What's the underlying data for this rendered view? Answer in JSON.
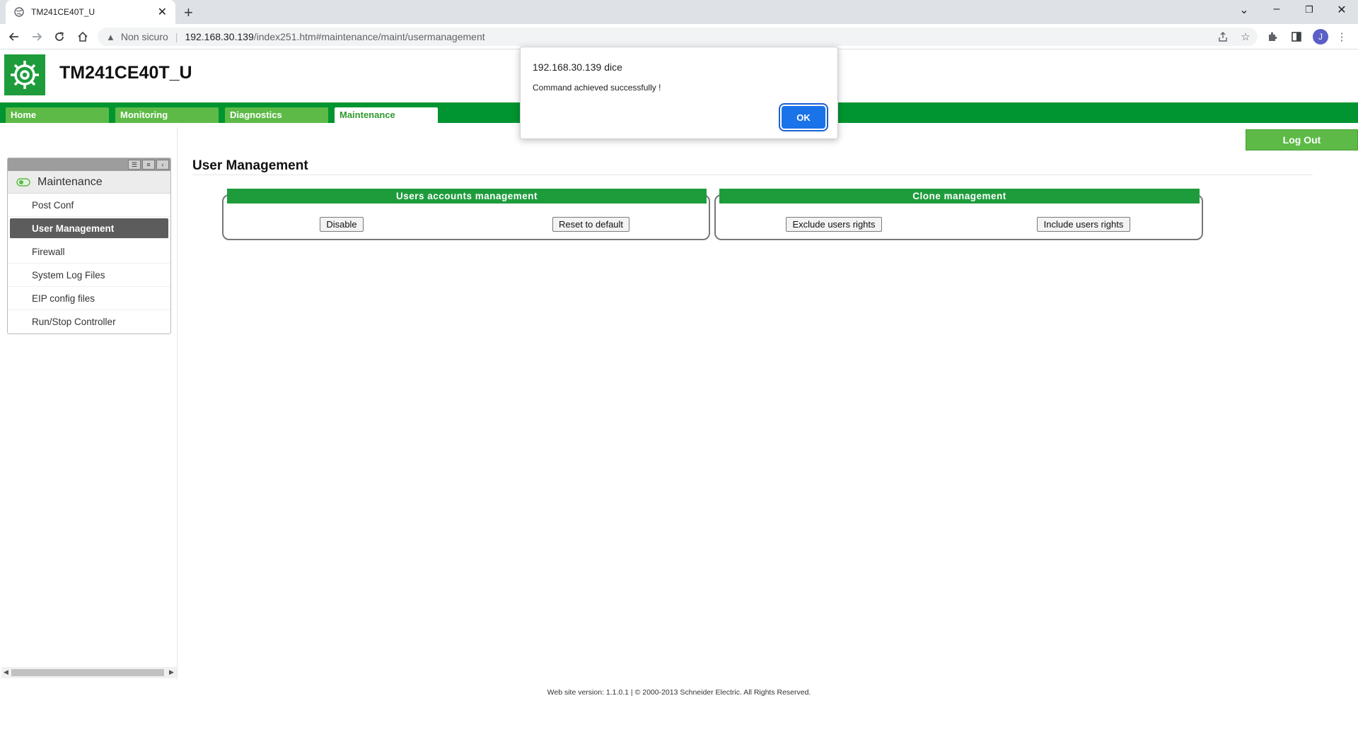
{
  "browser": {
    "tab_title": "TM241CE40T_U",
    "new_tab": "+",
    "security_label": "Non sicuro",
    "url_host": "192.168.30.139",
    "url_path": "/index251.htm#maintenance/maint/usermanagement",
    "profile_initial": "J",
    "icons": [
      "back-arrow-icon",
      "forward-arrow-icon",
      "reload-icon",
      "home-icon",
      "warning-icon",
      "share-icon",
      "star-icon",
      "extensions-icon",
      "sidepanel-icon",
      "menu-dots-icon"
    ]
  },
  "header": {
    "device_title": "TM241CE40T_U"
  },
  "nav": {
    "tabs": [
      "Home",
      "Monitoring",
      "Diagnostics",
      "Maintenance"
    ],
    "active_tab": "Maintenance",
    "logout_label": "Log Out"
  },
  "sidebar": {
    "section_title": "Maintenance",
    "items": [
      "Post Conf",
      "User Management",
      "Firewall",
      "System Log Files",
      "EIP config files",
      "Run/Stop Controller"
    ],
    "active_item": "User Management"
  },
  "main": {
    "page_title": "User Management",
    "groups": [
      {
        "title": "Users accounts management",
        "buttons": [
          "Disable",
          "Reset to default"
        ]
      },
      {
        "title": "Clone management",
        "buttons": [
          "Exclude users rights",
          "Include users rights"
        ]
      }
    ]
  },
  "footer": {
    "text": "Web site version: 1.1.0.1   |   © 2000-2013 Schneider Electric. All Rights Reserved."
  },
  "dialog": {
    "title": "192.168.30.139 dice",
    "message": "Command achieved successfully !",
    "ok_label": "OK"
  },
  "colors": {
    "brand_green": "#009530",
    "tab_green": "#5dba47",
    "dialog_blue": "#1a73e8"
  }
}
